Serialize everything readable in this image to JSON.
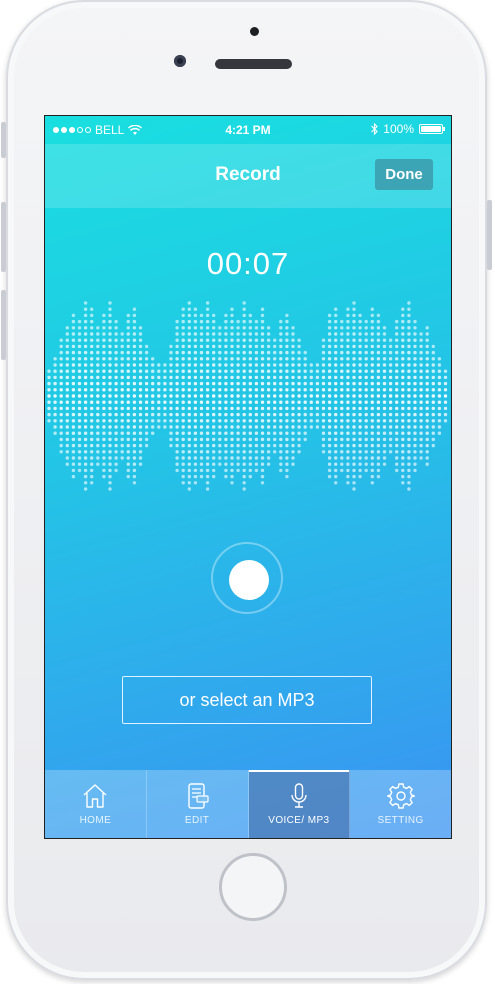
{
  "status_bar": {
    "carrier": "BELL",
    "time": "4:21 PM",
    "battery": "100%",
    "signal_dots_filled": 3,
    "signal_dots_total": 5
  },
  "nav": {
    "title": "Record",
    "done_label": "Done"
  },
  "recorder": {
    "timer": "00:07",
    "select_mp3_label": "or select an MP3"
  },
  "tabs": [
    {
      "label": "HOME",
      "icon": "home-icon",
      "active": false
    },
    {
      "label": "EDIT",
      "icon": "edit-icon",
      "active": false
    },
    {
      "label": "VOICE/ MP3",
      "icon": "microphone-icon",
      "active": true
    },
    {
      "label": "SETTING",
      "icon": "gear-icon",
      "active": false
    }
  ],
  "colors": {
    "gradient_top": "#19dfe0",
    "gradient_bottom": "#3a93f2",
    "accent": "#ffffff"
  }
}
